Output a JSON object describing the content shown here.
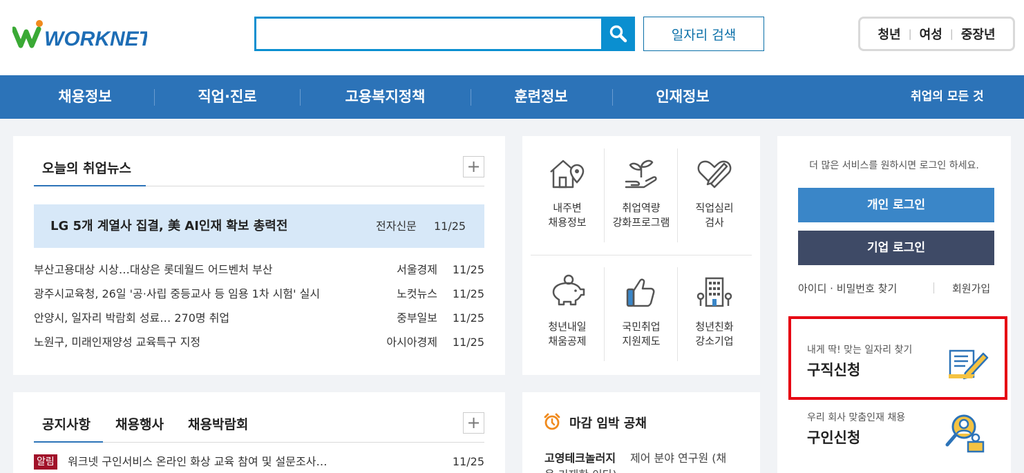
{
  "header": {
    "logo_text": "WORKNET",
    "search_placeholder": "",
    "job_search_label": "일자리 검색",
    "age_groups": [
      "청년",
      "여성",
      "중장년"
    ]
  },
  "nav": {
    "items": [
      "채용정보",
      "직업·진로",
      "고용복지정책",
      "훈련정보",
      "인재정보"
    ],
    "all_label": "취업의 모든 것"
  },
  "news": {
    "tab_title": "오늘의 취업뉴스",
    "plus": "+",
    "headline": {
      "title": "LG 5개 계열사 집결, 美 AI인재 확보 총력전",
      "source": "전자신문",
      "date": "11/25"
    },
    "items": [
      {
        "title": "부산고용대상 시상…대상은 롯데월드 어드벤처 부산",
        "source": "서울경제",
        "date": "11/25"
      },
      {
        "title": "광주시교육청, 26일 '공·사립 중등교사 등 임용 1차 시험' 실시",
        "source": "노컷뉴스",
        "date": "11/25"
      },
      {
        "title": "안양시, 일자리 박람회 성료… 270명 취업",
        "source": "중부일보",
        "date": "11/25"
      },
      {
        "title": "노원구, 미래인재양성 교육특구 지정",
        "source": "아시아경제",
        "date": "11/25"
      }
    ]
  },
  "services": {
    "row1": [
      {
        "icon": "house-location-icon",
        "label1": "내주변",
        "label2": "채용정보"
      },
      {
        "icon": "sprout-hand-icon",
        "label1": "취업역량",
        "label2": "강화프로그램"
      },
      {
        "icon": "heart-pencil-icon",
        "label1": "직업심리",
        "label2": "검사"
      }
    ],
    "row2": [
      {
        "icon": "piggy-bank-icon",
        "label1": "청년내일",
        "label2": "채움공제"
      },
      {
        "icon": "thumbs-up-icon",
        "label1": "국민취업",
        "label2": "지원제도"
      },
      {
        "icon": "building-icon",
        "label1": "청년친화",
        "label2": "강소기업"
      }
    ]
  },
  "login": {
    "message": "더 많은 서비스를 원하시면 로그인 하세요.",
    "personal_label": "개인 로그인",
    "company_label": "기업 로그인",
    "find_label": "아이디 · 비밀번호 찾기",
    "join_label": "회원가입"
  },
  "job_apply": {
    "sub": "내게 딱! 맞는 일자리 찾기",
    "main": "구직신청"
  },
  "hire_apply": {
    "sub": "우리 회사 맞춤인재 채용",
    "main": "구인신청"
  },
  "notice": {
    "tabs": [
      "공지사항",
      "채용행사",
      "채용박람회"
    ],
    "plus": "+",
    "items": [
      {
        "badge": "알림",
        "title": "워크넷 구인서비스 온라인 화상 교육 참여 및 설문조사…",
        "date": "11/25"
      }
    ]
  },
  "deadline": {
    "title": "마감 임박 공채",
    "company": "고영테크놀러지",
    "job": "제어 분야 연구원 (채",
    "job_cont": "용 기재한 이다)"
  },
  "colors": {
    "primary": "#2c73b8",
    "search": "#0a8fd0",
    "company_btn": "#3e4a66",
    "highlight": "#e60012",
    "headline_bg": "#d7e8f8"
  }
}
